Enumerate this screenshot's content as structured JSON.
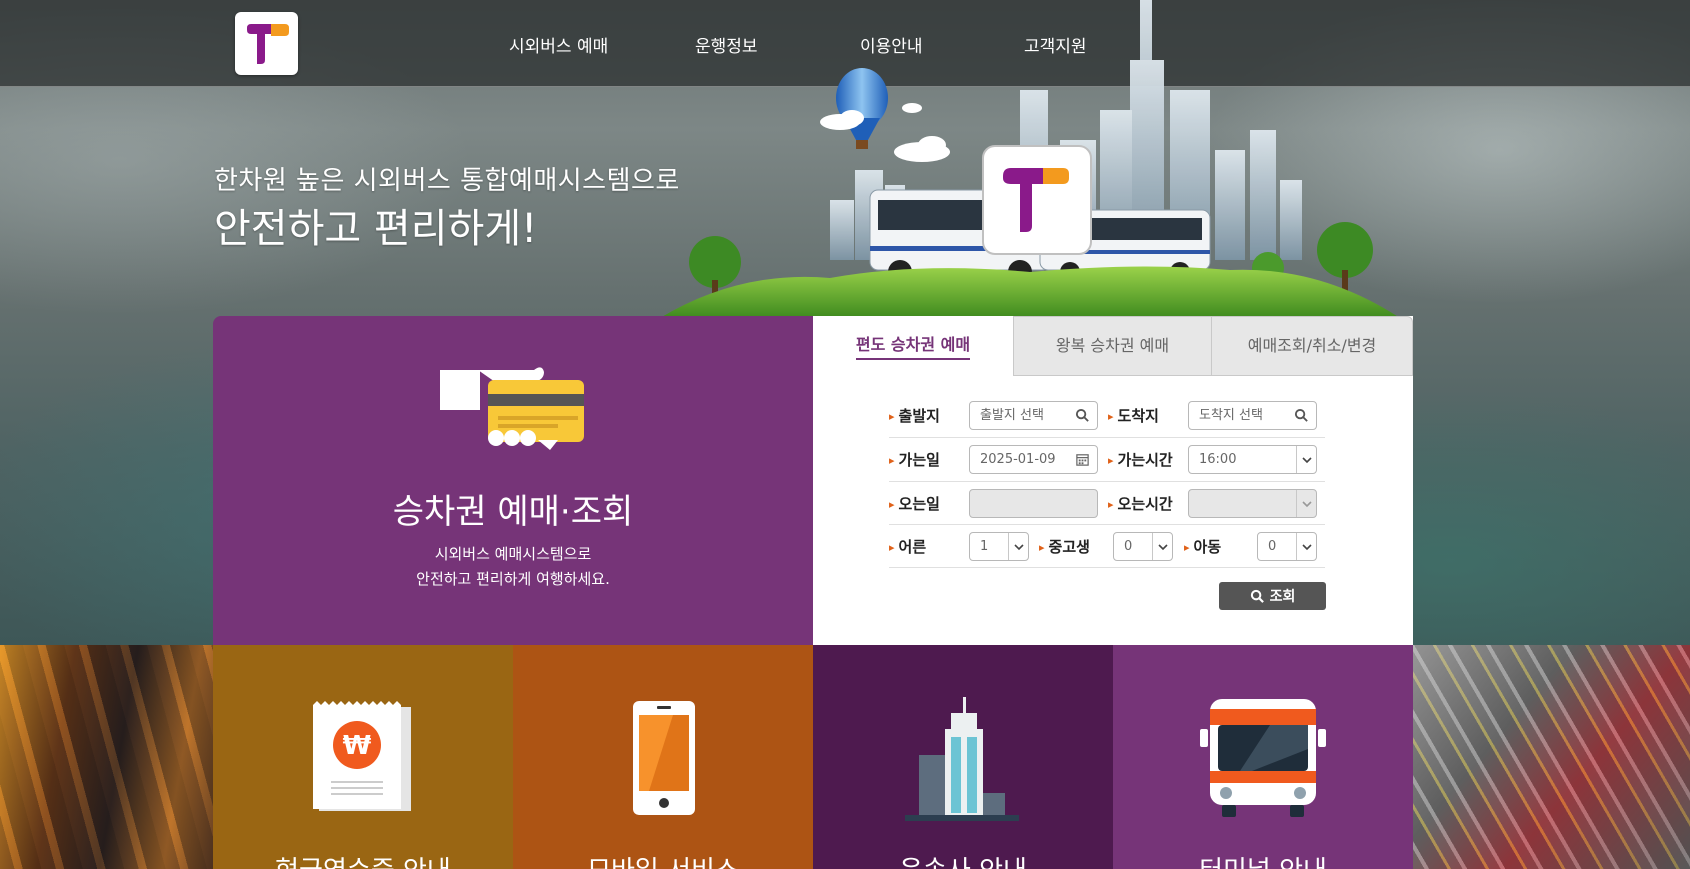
{
  "header": {
    "logo_name": "t-money-logo",
    "nav": [
      {
        "label": "시외버스 예매"
      },
      {
        "label": "운행정보"
      },
      {
        "label": "이용안내"
      },
      {
        "label": "고객지원"
      }
    ]
  },
  "hero": {
    "subtitle": "한차원 높은 시외버스 통합예매시스템으로",
    "title": "안전하고 편리하게!"
  },
  "booking_panel": {
    "title": "승차권 예매·조회",
    "desc_line1": "시외버스 예매시스템으로",
    "desc_line2": "안전하고 편리하게 여행하세요.",
    "icon": "hand-card-icon"
  },
  "tabs": [
    {
      "label": "편도 승차권 예매",
      "active": true
    },
    {
      "label": "왕복 승차권 예매",
      "active": false
    },
    {
      "label": "예매조회/취소/변경",
      "active": false
    }
  ],
  "form": {
    "departure_label": "출발지",
    "departure_placeholder": "출발지 선택",
    "arrival_label": "도착지",
    "arrival_placeholder": "도착지 선택",
    "go_date_label": "가는일",
    "go_date_value": "2025-01-09",
    "go_time_label": "가는시간",
    "go_time_value": "16:00",
    "return_date_label": "오는일",
    "return_date_value": "",
    "return_time_label": "오는시간",
    "return_time_value": "",
    "adult_label": "어른",
    "adult_value": "1",
    "student_label": "중고생",
    "student_value": "0",
    "child_label": "아동",
    "child_value": "0",
    "search_label": "조회"
  },
  "tiles": [
    {
      "label": "현금영수증 안내",
      "color": "#9a6613",
      "icon": "receipt-won-icon"
    },
    {
      "label": "모바일 서비스",
      "color": "#ad5414",
      "icon": "mobile-phone-icon"
    },
    {
      "label": "운송사 안내",
      "color": "#4e1a4f",
      "icon": "building-icon"
    },
    {
      "label": "터미널 안내",
      "color": "#763478",
      "icon": "bus-front-icon"
    }
  ],
  "colors": {
    "purple": "#763478",
    "orange_accent": "#e0621a",
    "logo_purple": "#8a1a8a",
    "logo_orange": "#f39a1e"
  }
}
